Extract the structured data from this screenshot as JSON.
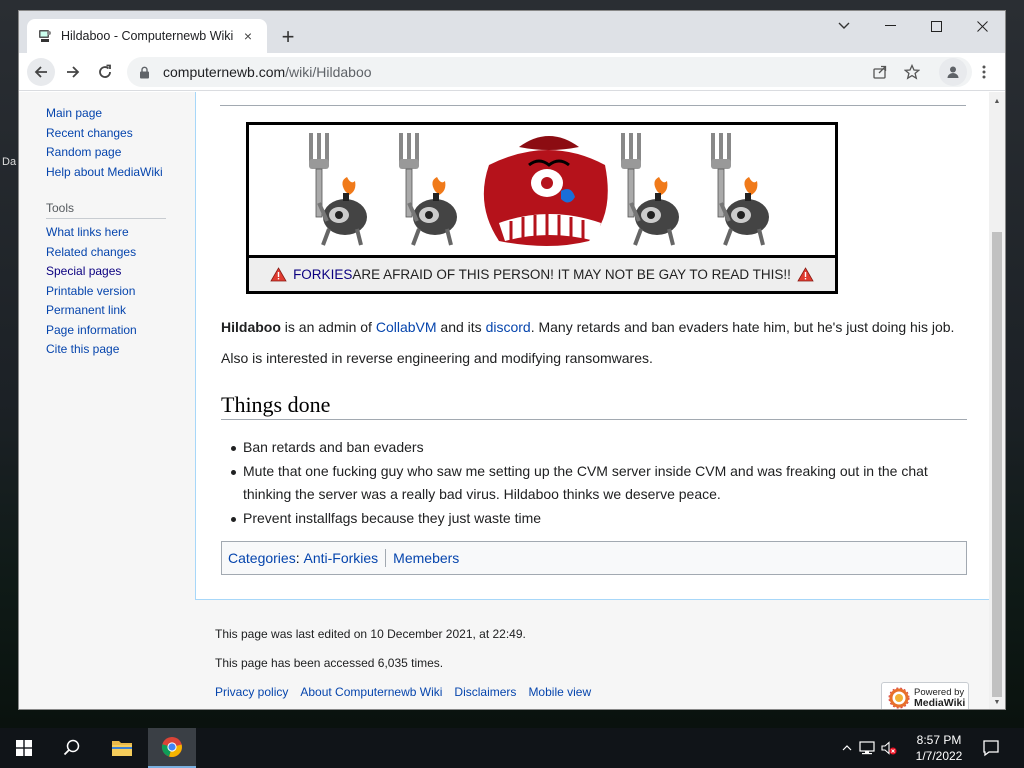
{
  "desktop": {
    "edge_label": "Da"
  },
  "browser": {
    "tab": {
      "title": "Hildaboo - Computernewb Wiki",
      "close_glyph": "×",
      "favicon": "computernewb-favicon-icon"
    },
    "new_tab_glyph": "+",
    "window_controls": {
      "tab_search_glyph": "⌄",
      "minimize_glyph": "—",
      "maximize_glyph": "☐",
      "close_glyph": "✕"
    },
    "address": {
      "host": "computernewb.com",
      "path": "/wiki/Hildaboo"
    },
    "icons": {
      "back": "arrow-left-icon",
      "forward": "arrow-right-icon",
      "reload": "reload-icon",
      "lock": "lock-icon",
      "share": "share-icon",
      "bookmark": "star-icon",
      "profile": "profile-icon",
      "menu": "kebab-menu-icon"
    }
  },
  "sidebar": {
    "nav": [
      {
        "label": "Main page"
      },
      {
        "label": "Recent changes"
      },
      {
        "label": "Random page"
      },
      {
        "label": "Help about MediaWiki"
      }
    ],
    "tools_heading": "Tools",
    "tools": [
      {
        "label": "What links here"
      },
      {
        "label": "Related changes"
      },
      {
        "label": "Special pages"
      },
      {
        "label": "Printable version"
      },
      {
        "label": "Permanent link"
      },
      {
        "label": "Page information"
      },
      {
        "label": "Cite this page"
      }
    ]
  },
  "article": {
    "banner": {
      "link_text": "FORKIES",
      "caption_text": " ARE AFRAID OF THIS PERSON! IT MAY NOT BE GAY TO READ THIS!!",
      "warning_icon": "warning-triangle-icon"
    },
    "intro": {
      "bold_name": "Hildaboo",
      "text1": " is an admin of ",
      "link1": "CollabVM",
      "text2": " and its ",
      "link2": "discord",
      "text3": ". Many retards and ban evaders hate him, but he's just doing his job."
    },
    "para2": "Also is interested in reverse engineering and modifying ransomwares.",
    "section_heading": "Things done",
    "things_done": [
      "Ban retards and ban evaders",
      "Mute that one fucking guy who saw me setting up the CVM server inside CVM and was freaking out in the chat thinking the server was a really bad virus. Hildaboo thinks we deserve peace.",
      "Prevent installfags because they just waste time"
    ],
    "categories": {
      "label": "Categories",
      "colon": ":",
      "items": [
        "Anti-Forkies",
        "Memebers"
      ]
    }
  },
  "footer": {
    "last_edited": "This page was last edited on 10 December 2021, at 22:49.",
    "accessed": "This page has been accessed 6,035 times.",
    "links": [
      "Privacy policy",
      "About Computernewb Wiki",
      "Disclaimers",
      "Mobile view"
    ],
    "powered_line1": "Powered by",
    "powered_line2": "MediaWiki"
  },
  "taskbar": {
    "time": "8:57 PM",
    "date": "1/7/2022",
    "items": [
      "windows-start-icon",
      "search-icon",
      "file-explorer-icon",
      "chrome-icon"
    ]
  }
}
